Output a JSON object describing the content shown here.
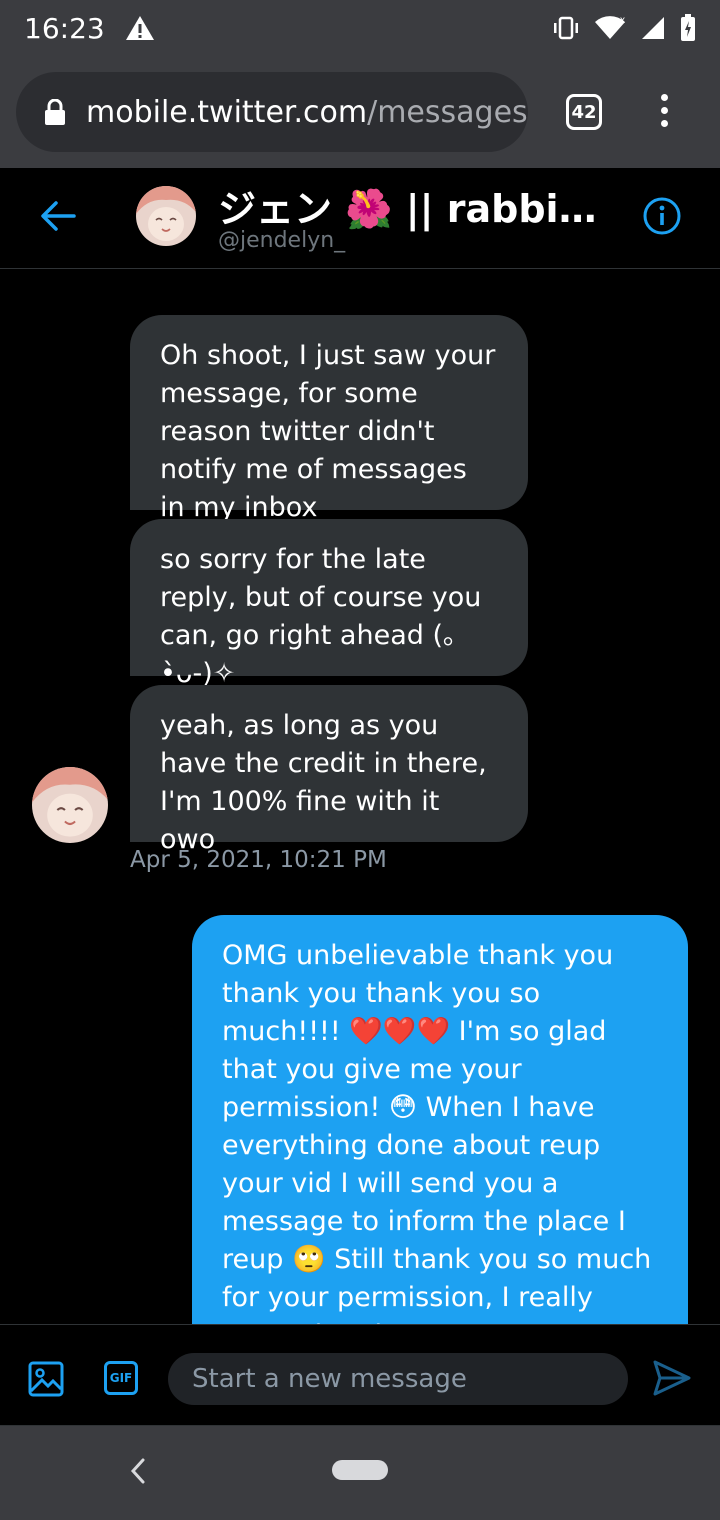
{
  "status_bar": {
    "time": "16:23",
    "icons": [
      "warning-icon",
      "vibrate-icon",
      "wifi-icon",
      "signal-icon",
      "battery-charging-icon"
    ]
  },
  "browser": {
    "url_host": "mobile.twitter.com",
    "url_path": "/messages",
    "tab_count": "42"
  },
  "conversation": {
    "name": "ジェン 🌺 || rabbitc...",
    "handle": "@jendelyn_"
  },
  "thread": {
    "incoming": [
      "Oh shoot, I just saw your message, for some reason twitter didn't notify me of messages in my inbox",
      "so sorry for the late reply, but of course you can, go right ahead (｡•̀ᴗ-)✧",
      "yeah, as long as you have the credit in there, I'm 100% fine with it owo"
    ],
    "incoming_timestamp": "Apr 5, 2021, 10:21 PM",
    "outgoing": "OMG unbelievable thank you thank you thank you so much!!!! ❤️❤️❤️ I'm so glad that you give me your permission! 😳 When I have everything done about reup your vid I will send you a message to inform the place I reup 🙄 Still thank you so much for your permission, I really appreciate it",
    "outgoing_hearts": "❤️❤️❤️"
  },
  "composer": {
    "placeholder": "Start a new message",
    "gif_label": "GIF"
  },
  "colors": {
    "accent": "#1da1f2",
    "bubble_in": "#2f3336",
    "chrome": "#3b3c40"
  }
}
